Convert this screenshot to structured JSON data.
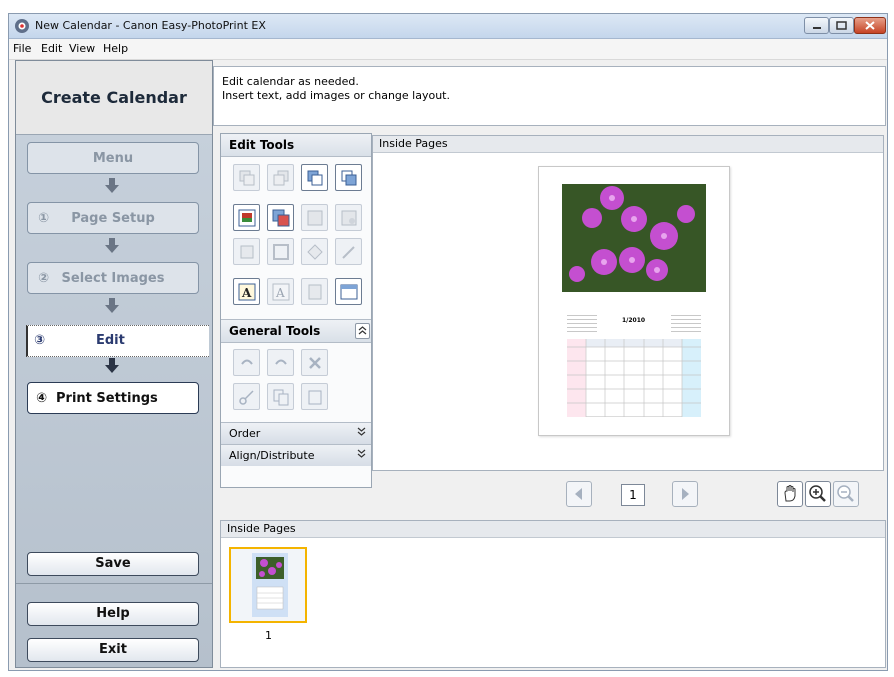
{
  "window": {
    "title": "New Calendar - Canon Easy-PhotoPrint EX"
  },
  "menubar": {
    "file": "File",
    "edit": "Edit",
    "view": "View",
    "help": "Help"
  },
  "leftnav": {
    "title": "Create Calendar",
    "steps": [
      {
        "num": "",
        "label": "Menu"
      },
      {
        "num": "①",
        "label": "Page Setup"
      },
      {
        "num": "②",
        "label": "Select Images"
      },
      {
        "num": "③",
        "label": "Edit"
      },
      {
        "num": "④",
        "label": "Print Settings"
      }
    ],
    "save": "Save",
    "help": "Help",
    "exit": "Exit"
  },
  "instruction": {
    "line1": "Edit calendar as needed.",
    "line2": "Insert text, add images or change layout."
  },
  "tools": {
    "edit_tools": "Edit Tools",
    "general_tools": "General Tools",
    "order": "Order",
    "align": "Align/Distribute"
  },
  "preview": {
    "header": "Inside Pages",
    "month_label": "1/2010",
    "page_number": "1"
  },
  "thumbs": {
    "header": "Inside Pages",
    "items": [
      {
        "label": "1"
      }
    ]
  },
  "colors": {
    "accent": "#f4b400",
    "nav_bg": "#b5c0cc",
    "title_bar": "#c4d6ec"
  }
}
